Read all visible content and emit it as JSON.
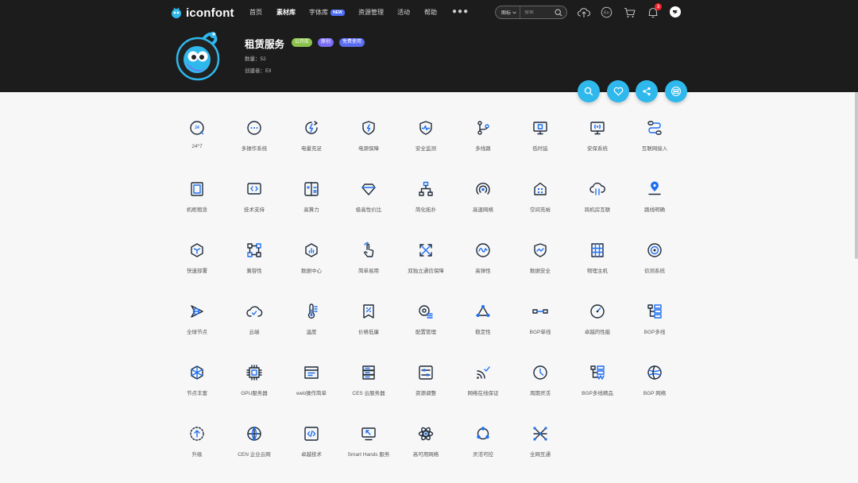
{
  "brand": {
    "name": "iconfont"
  },
  "nav": [
    {
      "label": "首页",
      "active": false
    },
    {
      "label": "素材库",
      "active": true
    },
    {
      "label": "字体库",
      "active": false,
      "badge": "NEW"
    },
    {
      "label": "资源管理",
      "active": false
    },
    {
      "label": "活动",
      "active": false
    },
    {
      "label": "帮助",
      "active": false
    }
  ],
  "nav_more": "●●●",
  "search": {
    "type": "图标",
    "placeholder": "搜索"
  },
  "notifications": {
    "count": "3"
  },
  "project": {
    "title": "租赁服务",
    "tags": [
      "公开库",
      "原创",
      "免费使用"
    ],
    "count_label": "数量：52",
    "creator_label": "创建者：Ell"
  },
  "colors": {
    "accent": "#2fb8ec",
    "header_bg": "#1c1c1c",
    "icon_blue": "#1d6ff2",
    "icon_dark": "#1e2a3b"
  },
  "icons": [
    {
      "label": "24*7",
      "icon": "clock-24-icon"
    },
    {
      "label": "多操作系统",
      "icon": "ellipsis-circle-icon"
    },
    {
      "label": "电量充足",
      "icon": "charge-icon"
    },
    {
      "label": "电源保障",
      "icon": "shield-bolt-icon"
    },
    {
      "label": "安全监测",
      "icon": "shield-pulse-icon"
    },
    {
      "label": "多线路",
      "icon": "branch-icon"
    },
    {
      "label": "低时延",
      "icon": "monitor-chip-icon"
    },
    {
      "label": "安保系统",
      "icon": "monitor-signal-icon"
    },
    {
      "label": "互联网接入",
      "icon": "route-icon"
    },
    {
      "label": "机柜租赁",
      "icon": "cabinet-icon"
    },
    {
      "label": "技术支持",
      "icon": "code-window-icon"
    },
    {
      "label": "高算力",
      "icon": "calculator-icon"
    },
    {
      "label": "极高性价比",
      "icon": "diamond-icon"
    },
    {
      "label": "简化拓扑",
      "icon": "topology-icon"
    },
    {
      "label": "高速网络",
      "icon": "radar-icon"
    },
    {
      "label": "空间充裕",
      "icon": "house-grid-icon"
    },
    {
      "label": "跨机房互联",
      "icon": "cloud-link-icon"
    },
    {
      "label": "路线明确",
      "icon": "location-pin-icon"
    },
    {
      "label": "快速部署",
      "icon": "hexagon-deploy-icon"
    },
    {
      "label": "兼容性",
      "icon": "nodes-icon"
    },
    {
      "label": "数据中心",
      "icon": "hexagon-chart-icon"
    },
    {
      "label": "简单易用",
      "icon": "hand-pointer-icon"
    },
    {
      "label": "双独立通信保障",
      "icon": "cross-arrows-icon"
    },
    {
      "label": "高弹性",
      "icon": "elastic-icon"
    },
    {
      "label": "数据安全",
      "icon": "shield-wave-icon"
    },
    {
      "label": "物理主机",
      "icon": "server-rack-icon"
    },
    {
      "label": "侦测系统",
      "icon": "target-icon"
    },
    {
      "label": "全球节点",
      "icon": "globe-nodes-icon"
    },
    {
      "label": "云端",
      "icon": "cloud-check-icon"
    },
    {
      "label": "温度",
      "icon": "thermometer-icon"
    },
    {
      "label": "价格低廉",
      "icon": "price-tag-icon"
    },
    {
      "label": "配置管理",
      "icon": "gear-list-icon"
    },
    {
      "label": "稳定性",
      "icon": "triangle-nodes-icon"
    },
    {
      "label": "BGP单线",
      "icon": "single-line-icon"
    },
    {
      "label": "卓越的性能",
      "icon": "gauge-icon"
    },
    {
      "label": "BGP多线",
      "icon": "tree-list-icon"
    },
    {
      "label": "节点丰富",
      "icon": "snowflake-nodes-icon"
    },
    {
      "label": "GPU服务器",
      "icon": "chip-icon"
    },
    {
      "label": "web操作简单",
      "icon": "web-window-icon"
    },
    {
      "label": "CES 云服务器",
      "icon": "server-stack-icon"
    },
    {
      "label": "资源调整",
      "icon": "sliders-icon"
    },
    {
      "label": "网络在线保证",
      "icon": "signal-check-icon"
    },
    {
      "label": "周期灵活",
      "icon": "clock-icon"
    },
    {
      "label": "BGP多线精品",
      "icon": "tree-premium-icon"
    },
    {
      "label": "BGP 网络",
      "icon": "globe-icon"
    },
    {
      "label": "升级",
      "icon": "upgrade-icon"
    },
    {
      "label": "CEN 企业云网",
      "icon": "globe-network-icon"
    },
    {
      "label": "卓越技术",
      "icon": "code-box-icon"
    },
    {
      "label": "Smart Hands 服务",
      "icon": "monitor-arrow-icon"
    },
    {
      "label": "高可用网络",
      "icon": "atom-icon"
    },
    {
      "label": "灵活可控",
      "icon": "cycle-nodes-icon"
    },
    {
      "label": "全网互通",
      "icon": "mesh-icon"
    }
  ]
}
